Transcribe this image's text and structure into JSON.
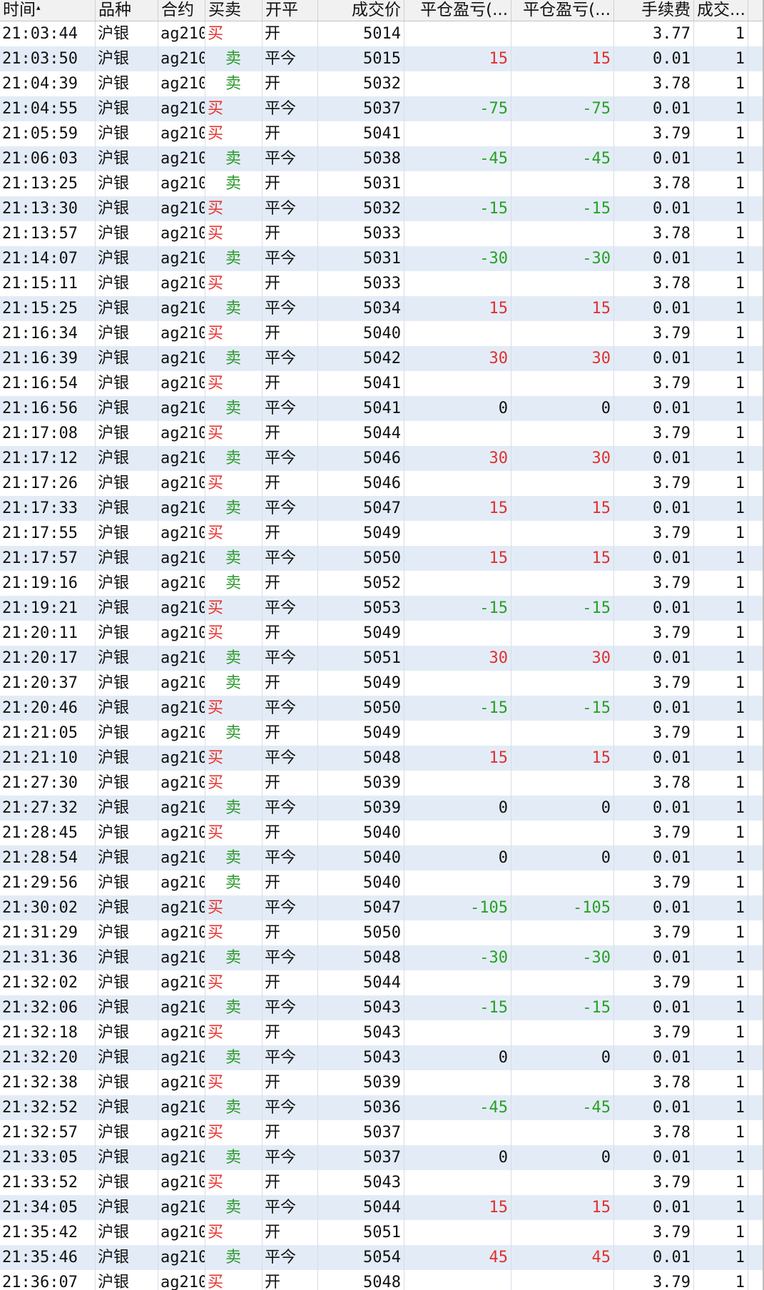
{
  "columns": [
    {
      "label": "时间",
      "sortable": true,
      "sort": "asc"
    },
    {
      "label": "品种"
    },
    {
      "label": "合约"
    },
    {
      "label": "买卖"
    },
    {
      "label": "开平"
    },
    {
      "label": "成交价"
    },
    {
      "label": "平仓盈亏(..."
    },
    {
      "label": "平仓盈亏(..."
    },
    {
      "label": "手续费"
    },
    {
      "label": "成交..."
    }
  ],
  "sort_icon": "▴",
  "rows": [
    {
      "time": "21:03:44",
      "product": "沪银",
      "contract": "ag210",
      "side": "买",
      "offset": "开",
      "price": "5014",
      "pnl1": "",
      "pnl2": "",
      "fee": "3.77",
      "qty": "1"
    },
    {
      "time": "21:03:50",
      "product": "沪银",
      "contract": "ag210",
      "side": "卖",
      "offset": "平今",
      "price": "5015",
      "pnl1": "15",
      "pnl2": "15",
      "fee": "0.01",
      "qty": "1"
    },
    {
      "time": "21:04:39",
      "product": "沪银",
      "contract": "ag210",
      "side": "卖",
      "offset": "开",
      "price": "5032",
      "pnl1": "",
      "pnl2": "",
      "fee": "3.78",
      "qty": "1"
    },
    {
      "time": "21:04:55",
      "product": "沪银",
      "contract": "ag210",
      "side": "买",
      "offset": "平今",
      "price": "5037",
      "pnl1": "-75",
      "pnl2": "-75",
      "fee": "0.01",
      "qty": "1"
    },
    {
      "time": "21:05:59",
      "product": "沪银",
      "contract": "ag210",
      "side": "买",
      "offset": "开",
      "price": "5041",
      "pnl1": "",
      "pnl2": "",
      "fee": "3.79",
      "qty": "1"
    },
    {
      "time": "21:06:03",
      "product": "沪银",
      "contract": "ag210",
      "side": "卖",
      "offset": "平今",
      "price": "5038",
      "pnl1": "-45",
      "pnl2": "-45",
      "fee": "0.01",
      "qty": "1"
    },
    {
      "time": "21:13:25",
      "product": "沪银",
      "contract": "ag210",
      "side": "卖",
      "offset": "开",
      "price": "5031",
      "pnl1": "",
      "pnl2": "",
      "fee": "3.78",
      "qty": "1"
    },
    {
      "time": "21:13:30",
      "product": "沪银",
      "contract": "ag210",
      "side": "买",
      "offset": "平今",
      "price": "5032",
      "pnl1": "-15",
      "pnl2": "-15",
      "fee": "0.01",
      "qty": "1"
    },
    {
      "time": "21:13:57",
      "product": "沪银",
      "contract": "ag210",
      "side": "买",
      "offset": "开",
      "price": "5033",
      "pnl1": "",
      "pnl2": "",
      "fee": "3.78",
      "qty": "1"
    },
    {
      "time": "21:14:07",
      "product": "沪银",
      "contract": "ag210",
      "side": "卖",
      "offset": "平今",
      "price": "5031",
      "pnl1": "-30",
      "pnl2": "-30",
      "fee": "0.01",
      "qty": "1"
    },
    {
      "time": "21:15:11",
      "product": "沪银",
      "contract": "ag210",
      "side": "买",
      "offset": "开",
      "price": "5033",
      "pnl1": "",
      "pnl2": "",
      "fee": "3.78",
      "qty": "1"
    },
    {
      "time": "21:15:25",
      "product": "沪银",
      "contract": "ag210",
      "side": "卖",
      "offset": "平今",
      "price": "5034",
      "pnl1": "15",
      "pnl2": "15",
      "fee": "0.01",
      "qty": "1"
    },
    {
      "time": "21:16:34",
      "product": "沪银",
      "contract": "ag210",
      "side": "买",
      "offset": "开",
      "price": "5040",
      "pnl1": "",
      "pnl2": "",
      "fee": "3.79",
      "qty": "1"
    },
    {
      "time": "21:16:39",
      "product": "沪银",
      "contract": "ag210",
      "side": "卖",
      "offset": "平今",
      "price": "5042",
      "pnl1": "30",
      "pnl2": "30",
      "fee": "0.01",
      "qty": "1"
    },
    {
      "time": "21:16:54",
      "product": "沪银",
      "contract": "ag210",
      "side": "买",
      "offset": "开",
      "price": "5041",
      "pnl1": "",
      "pnl2": "",
      "fee": "3.79",
      "qty": "1"
    },
    {
      "time": "21:16:56",
      "product": "沪银",
      "contract": "ag210",
      "side": "卖",
      "offset": "平今",
      "price": "5041",
      "pnl1": "0",
      "pnl2": "0",
      "fee": "0.01",
      "qty": "1"
    },
    {
      "time": "21:17:08",
      "product": "沪银",
      "contract": "ag210",
      "side": "买",
      "offset": "开",
      "price": "5044",
      "pnl1": "",
      "pnl2": "",
      "fee": "3.79",
      "qty": "1"
    },
    {
      "time": "21:17:12",
      "product": "沪银",
      "contract": "ag210",
      "side": "卖",
      "offset": "平今",
      "price": "5046",
      "pnl1": "30",
      "pnl2": "30",
      "fee": "0.01",
      "qty": "1"
    },
    {
      "time": "21:17:26",
      "product": "沪银",
      "contract": "ag210",
      "side": "买",
      "offset": "开",
      "price": "5046",
      "pnl1": "",
      "pnl2": "",
      "fee": "3.79",
      "qty": "1"
    },
    {
      "time": "21:17:33",
      "product": "沪银",
      "contract": "ag210",
      "side": "卖",
      "offset": "平今",
      "price": "5047",
      "pnl1": "15",
      "pnl2": "15",
      "fee": "0.01",
      "qty": "1"
    },
    {
      "time": "21:17:55",
      "product": "沪银",
      "contract": "ag210",
      "side": "买",
      "offset": "开",
      "price": "5049",
      "pnl1": "",
      "pnl2": "",
      "fee": "3.79",
      "qty": "1"
    },
    {
      "time": "21:17:57",
      "product": "沪银",
      "contract": "ag210",
      "side": "卖",
      "offset": "平今",
      "price": "5050",
      "pnl1": "15",
      "pnl2": "15",
      "fee": "0.01",
      "qty": "1"
    },
    {
      "time": "21:19:16",
      "product": "沪银",
      "contract": "ag210",
      "side": "卖",
      "offset": "开",
      "price": "5052",
      "pnl1": "",
      "pnl2": "",
      "fee": "3.79",
      "qty": "1"
    },
    {
      "time": "21:19:21",
      "product": "沪银",
      "contract": "ag210",
      "side": "买",
      "offset": "平今",
      "price": "5053",
      "pnl1": "-15",
      "pnl2": "-15",
      "fee": "0.01",
      "qty": "1"
    },
    {
      "time": "21:20:11",
      "product": "沪银",
      "contract": "ag210",
      "side": "买",
      "offset": "开",
      "price": "5049",
      "pnl1": "",
      "pnl2": "",
      "fee": "3.79",
      "qty": "1"
    },
    {
      "time": "21:20:17",
      "product": "沪银",
      "contract": "ag210",
      "side": "卖",
      "offset": "平今",
      "price": "5051",
      "pnl1": "30",
      "pnl2": "30",
      "fee": "0.01",
      "qty": "1"
    },
    {
      "time": "21:20:37",
      "product": "沪银",
      "contract": "ag210",
      "side": "卖",
      "offset": "开",
      "price": "5049",
      "pnl1": "",
      "pnl2": "",
      "fee": "3.79",
      "qty": "1"
    },
    {
      "time": "21:20:46",
      "product": "沪银",
      "contract": "ag210",
      "side": "买",
      "offset": "平今",
      "price": "5050",
      "pnl1": "-15",
      "pnl2": "-15",
      "fee": "0.01",
      "qty": "1"
    },
    {
      "time": "21:21:05",
      "product": "沪银",
      "contract": "ag210",
      "side": "卖",
      "offset": "开",
      "price": "5049",
      "pnl1": "",
      "pnl2": "",
      "fee": "3.79",
      "qty": "1"
    },
    {
      "time": "21:21:10",
      "product": "沪银",
      "contract": "ag210",
      "side": "买",
      "offset": "平今",
      "price": "5048",
      "pnl1": "15",
      "pnl2": "15",
      "fee": "0.01",
      "qty": "1"
    },
    {
      "time": "21:27:30",
      "product": "沪银",
      "contract": "ag210",
      "side": "买",
      "offset": "开",
      "price": "5039",
      "pnl1": "",
      "pnl2": "",
      "fee": "3.78",
      "qty": "1"
    },
    {
      "time": "21:27:32",
      "product": "沪银",
      "contract": "ag210",
      "side": "卖",
      "offset": "平今",
      "price": "5039",
      "pnl1": "0",
      "pnl2": "0",
      "fee": "0.01",
      "qty": "1"
    },
    {
      "time": "21:28:45",
      "product": "沪银",
      "contract": "ag210",
      "side": "买",
      "offset": "开",
      "price": "5040",
      "pnl1": "",
      "pnl2": "",
      "fee": "3.79",
      "qty": "1"
    },
    {
      "time": "21:28:54",
      "product": "沪银",
      "contract": "ag210",
      "side": "卖",
      "offset": "平今",
      "price": "5040",
      "pnl1": "0",
      "pnl2": "0",
      "fee": "0.01",
      "qty": "1"
    },
    {
      "time": "21:29:56",
      "product": "沪银",
      "contract": "ag210",
      "side": "卖",
      "offset": "开",
      "price": "5040",
      "pnl1": "",
      "pnl2": "",
      "fee": "3.79",
      "qty": "1"
    },
    {
      "time": "21:30:02",
      "product": "沪银",
      "contract": "ag210",
      "side": "买",
      "offset": "平今",
      "price": "5047",
      "pnl1": "-105",
      "pnl2": "-105",
      "fee": "0.01",
      "qty": "1"
    },
    {
      "time": "21:31:29",
      "product": "沪银",
      "contract": "ag210",
      "side": "买",
      "offset": "开",
      "price": "5050",
      "pnl1": "",
      "pnl2": "",
      "fee": "3.79",
      "qty": "1"
    },
    {
      "time": "21:31:36",
      "product": "沪银",
      "contract": "ag210",
      "side": "卖",
      "offset": "平今",
      "price": "5048",
      "pnl1": "-30",
      "pnl2": "-30",
      "fee": "0.01",
      "qty": "1"
    },
    {
      "time": "21:32:02",
      "product": "沪银",
      "contract": "ag210",
      "side": "买",
      "offset": "开",
      "price": "5044",
      "pnl1": "",
      "pnl2": "",
      "fee": "3.79",
      "qty": "1"
    },
    {
      "time": "21:32:06",
      "product": "沪银",
      "contract": "ag210",
      "side": "卖",
      "offset": "平今",
      "price": "5043",
      "pnl1": "-15",
      "pnl2": "-15",
      "fee": "0.01",
      "qty": "1"
    },
    {
      "time": "21:32:18",
      "product": "沪银",
      "contract": "ag210",
      "side": "买",
      "offset": "开",
      "price": "5043",
      "pnl1": "",
      "pnl2": "",
      "fee": "3.79",
      "qty": "1"
    },
    {
      "time": "21:32:20",
      "product": "沪银",
      "contract": "ag210",
      "side": "卖",
      "offset": "平今",
      "price": "5043",
      "pnl1": "0",
      "pnl2": "0",
      "fee": "0.01",
      "qty": "1"
    },
    {
      "time": "21:32:38",
      "product": "沪银",
      "contract": "ag210",
      "side": "买",
      "offset": "开",
      "price": "5039",
      "pnl1": "",
      "pnl2": "",
      "fee": "3.78",
      "qty": "1"
    },
    {
      "time": "21:32:52",
      "product": "沪银",
      "contract": "ag210",
      "side": "卖",
      "offset": "平今",
      "price": "5036",
      "pnl1": "-45",
      "pnl2": "-45",
      "fee": "0.01",
      "qty": "1"
    },
    {
      "time": "21:32:57",
      "product": "沪银",
      "contract": "ag210",
      "side": "买",
      "offset": "开",
      "price": "5037",
      "pnl1": "",
      "pnl2": "",
      "fee": "3.78",
      "qty": "1"
    },
    {
      "time": "21:33:05",
      "product": "沪银",
      "contract": "ag210",
      "side": "卖",
      "offset": "平今",
      "price": "5037",
      "pnl1": "0",
      "pnl2": "0",
      "fee": "0.01",
      "qty": "1"
    },
    {
      "time": "21:33:52",
      "product": "沪银",
      "contract": "ag210",
      "side": "买",
      "offset": "开",
      "price": "5043",
      "pnl1": "",
      "pnl2": "",
      "fee": "3.79",
      "qty": "1"
    },
    {
      "time": "21:34:05",
      "product": "沪银",
      "contract": "ag210",
      "side": "卖",
      "offset": "平今",
      "price": "5044",
      "pnl1": "15",
      "pnl2": "15",
      "fee": "0.01",
      "qty": "1"
    },
    {
      "time": "21:35:42",
      "product": "沪银",
      "contract": "ag210",
      "side": "买",
      "offset": "开",
      "price": "5051",
      "pnl1": "",
      "pnl2": "",
      "fee": "3.79",
      "qty": "1"
    },
    {
      "time": "21:35:46",
      "product": "沪银",
      "contract": "ag210",
      "side": "卖",
      "offset": "平今",
      "price": "5054",
      "pnl1": "45",
      "pnl2": "45",
      "fee": "0.01",
      "qty": "1"
    },
    {
      "time": "21:36:07",
      "product": "沪银",
      "contract": "ag210",
      "side": "买",
      "offset": "开",
      "price": "5048",
      "pnl1": "",
      "pnl2": "",
      "fee": "3.79",
      "qty": "1"
    }
  ],
  "colors": {
    "buy": "#e8302c",
    "sell": "#2c9a2c",
    "profit": "#e03030",
    "loss": "#26a026",
    "alt_row": "#e3ecf6",
    "header_bg": "#f1f1f1"
  }
}
